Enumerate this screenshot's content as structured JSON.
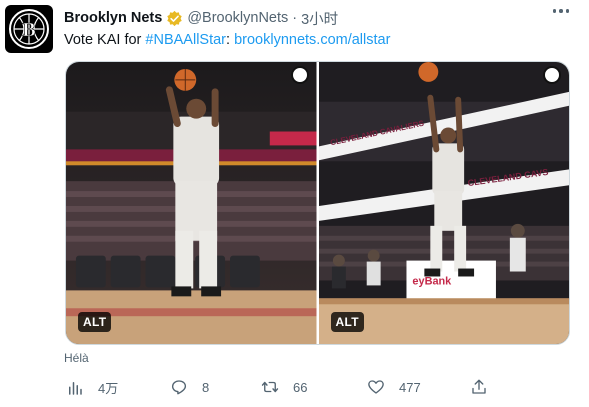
{
  "tweet": {
    "author_name": "Brooklyn Nets",
    "handle": "@BrooklynNets",
    "separator": "·",
    "time": "3小时",
    "text_prefix": "Vote KAI for ",
    "hashtag": "#NBAAllStar",
    "text_colon": ": ",
    "url": "brooklynnets.com/allstar",
    "photo_badges": [
      "ALT",
      "ALT"
    ],
    "arena_signs": [
      "CLEVELAND CAVALIERS",
      "CLEVELAND CAVS",
      "eyBank"
    ],
    "caption": "Hélà",
    "stats": {
      "views": "4万",
      "replies": "8",
      "retweets": "66",
      "likes": "477"
    }
  },
  "icons": [
    "nets-logo-icon",
    "verified-badge-icon",
    "more-options-icon",
    "views-icon",
    "reply-icon",
    "retweet-icon",
    "like-icon",
    "share-icon"
  ],
  "colors": {
    "link": "#1d9bf0",
    "secondary_text": "#536471",
    "verified_gold": "#e8b923",
    "cavs_wine": "#7a1f3d"
  }
}
